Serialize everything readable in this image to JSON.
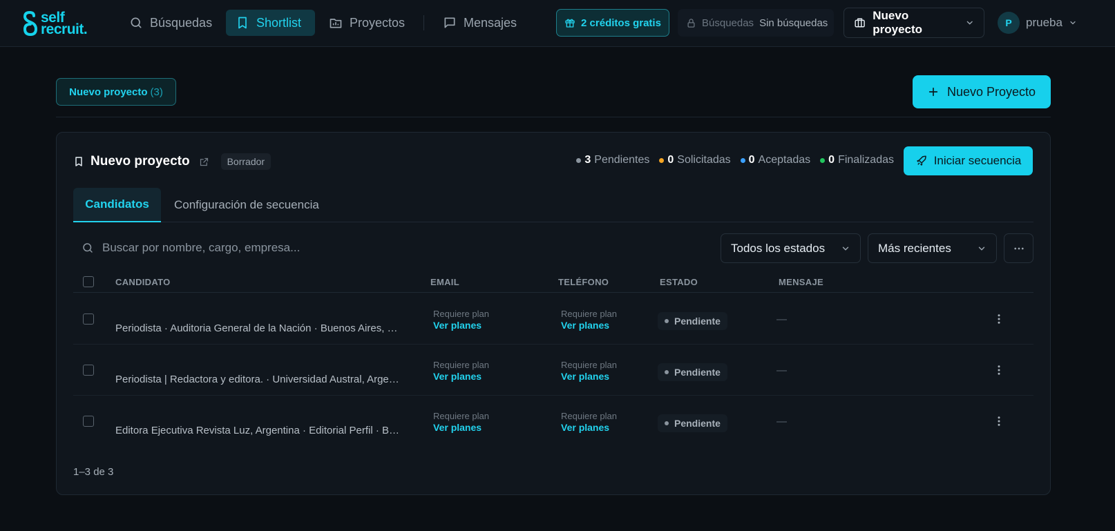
{
  "logo": {
    "line1": "self",
    "line2": "recruit."
  },
  "nav": [
    {
      "label": "Búsquedas",
      "icon": "search-icon"
    },
    {
      "label": "Shortlist",
      "icon": "bookmark-icon",
      "active": true
    },
    {
      "label": "Proyectos",
      "icon": "folder-icon"
    },
    {
      "label": "Mensajes",
      "icon": "message-icon"
    }
  ],
  "credits": {
    "label": "2 créditos gratis",
    "icon": "gift-icon"
  },
  "searches_badge": {
    "label": "Búsquedas",
    "value": "Sin búsquedas",
    "icon": "lock-icon"
  },
  "project_selector": {
    "label": "Nuevo proyecto",
    "icon": "briefcase-icon"
  },
  "user": {
    "initial": "P",
    "name": "prueba"
  },
  "project_tab": {
    "label": "Nuevo proyecto",
    "count": "(3)"
  },
  "new_project_button": {
    "label": "Nuevo Proyecto"
  },
  "card": {
    "title": "Nuevo proyecto",
    "draft_badge": "Borrador",
    "stats": [
      {
        "count": "3",
        "label": "Pendientes",
        "color": "#8a949e"
      },
      {
        "count": "0",
        "label": "Solicitadas",
        "color": "#f5a524"
      },
      {
        "count": "0",
        "label": "Aceptadas",
        "color": "#3aa0ff"
      },
      {
        "count": "0",
        "label": "Finalizadas",
        "color": "#22c55e"
      }
    ],
    "start_button": "Iniciar secuencia",
    "tabs": [
      "Candidatos",
      "Configuración de secuencia"
    ],
    "search_placeholder": "Buscar por nombre, cargo, empresa...",
    "status_filter": "Todos los estados",
    "sort_filter": "Más recientes",
    "columns": [
      "CANDIDATO",
      "EMAIL",
      "TELÉFONO",
      "ESTADO",
      "MENSAJE"
    ],
    "rows": [
      {
        "candidate": "Periodista · Auditoria General de la Nación · Buenos Aires, Buenos Aires, Argentina",
        "email_label": "Requiere plan",
        "email_link": "Ver planes",
        "phone_label": "Requiere plan",
        "phone_link": "Ver planes",
        "status": "Pendiente",
        "message": "—"
      },
      {
        "candidate": "Periodista | Redactora y editora. · Universidad Austral, Argentina",
        "email_label": "Requiere plan",
        "email_link": "Ver planes",
        "phone_label": "Requiere plan",
        "phone_link": "Ver planes",
        "status": "Pendiente",
        "message": "—"
      },
      {
        "candidate": "Editora Ejecutiva Revista Luz, Argentina · Editorial Perfil · Buenos Aires",
        "email_label": "Requiere plan",
        "email_link": "Ver planes",
        "phone_label": "Requiere plan",
        "phone_link": "Ver planes",
        "status": "Pendiente",
        "message": "—"
      }
    ],
    "pagination": "1–3 de 3"
  },
  "colors": {
    "accent": "#17d0ec",
    "background": "#0b0f14",
    "card": "#10161d"
  }
}
